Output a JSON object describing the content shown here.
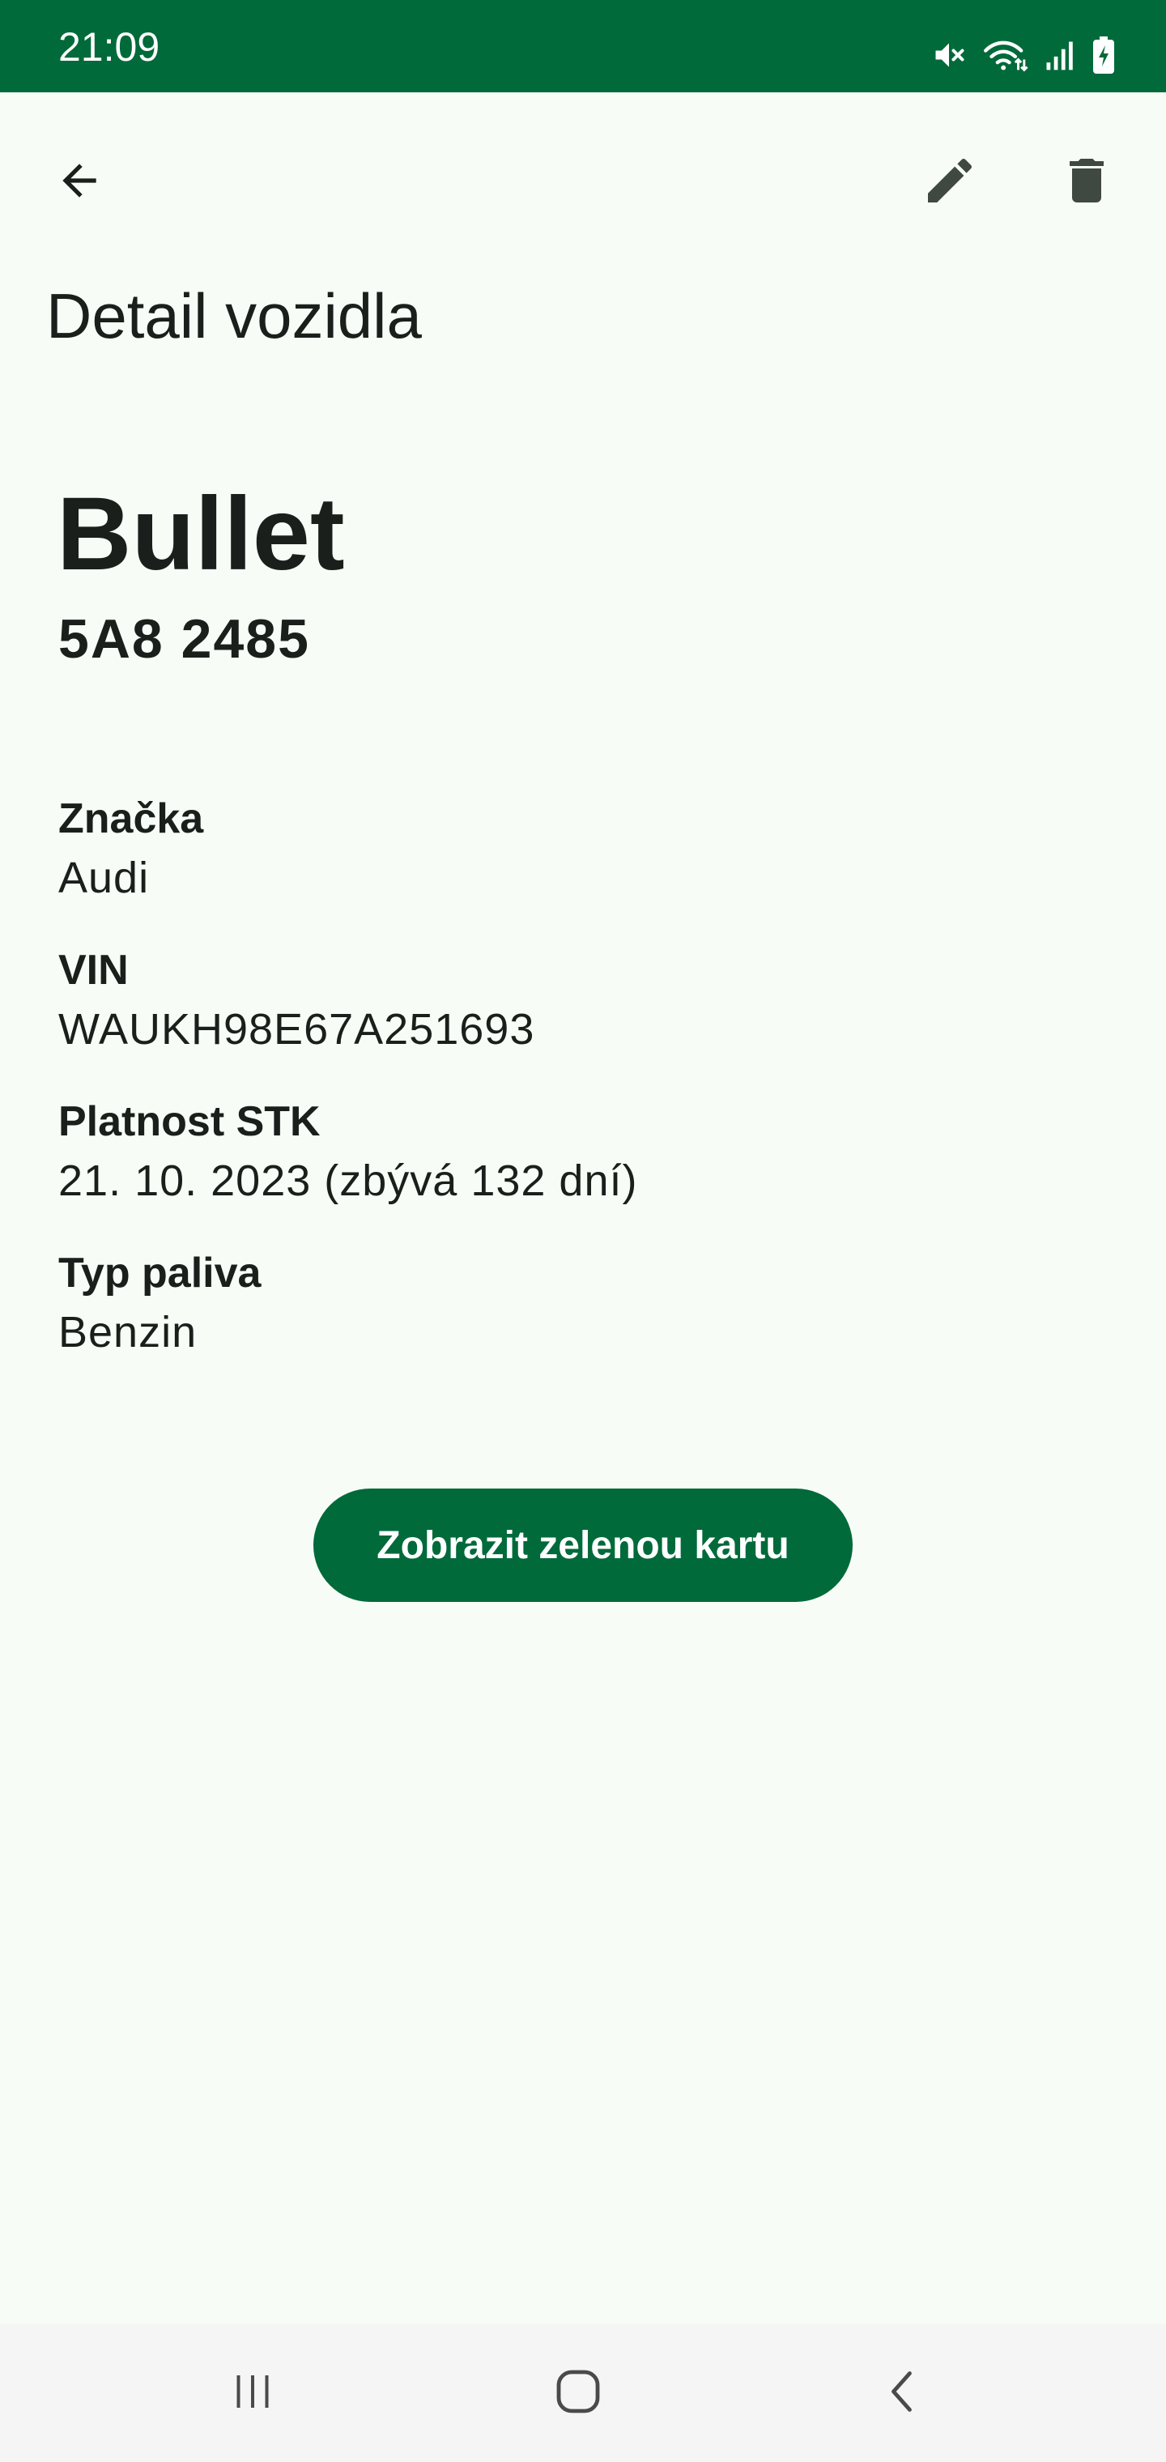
{
  "status_bar": {
    "time": "21:09",
    "icons": [
      "mute-icon",
      "wifi-icon",
      "signal-icon",
      "battery-charging-icon"
    ],
    "background": "#006a3a"
  },
  "app_bar": {
    "title": "Detail vozidla",
    "back_icon": "arrow-back-icon",
    "edit_icon": "edit-icon",
    "delete_icon": "delete-icon"
  },
  "vehicle": {
    "name": "Bullet",
    "plate": "5A8 2485"
  },
  "details": [
    {
      "label": "Značka",
      "value": "Audi"
    },
    {
      "label": "VIN",
      "value": "WAUKH98E67A251693"
    },
    {
      "label": "Platnost STK",
      "value": "21. 10. 2023 (zbývá 132 dní)"
    },
    {
      "label": "Typ paliva",
      "value": "Benzin"
    }
  ],
  "actions": {
    "green_card_label": "Zobrazit zelenou kartu"
  },
  "nav_bar": {
    "icons": [
      "recent-apps-icon",
      "home-icon",
      "back-icon"
    ]
  },
  "colors": {
    "accent": "#006a3a",
    "background": "#f8fcf7",
    "text": "#1b1f1c",
    "icon": "#3f4942"
  }
}
